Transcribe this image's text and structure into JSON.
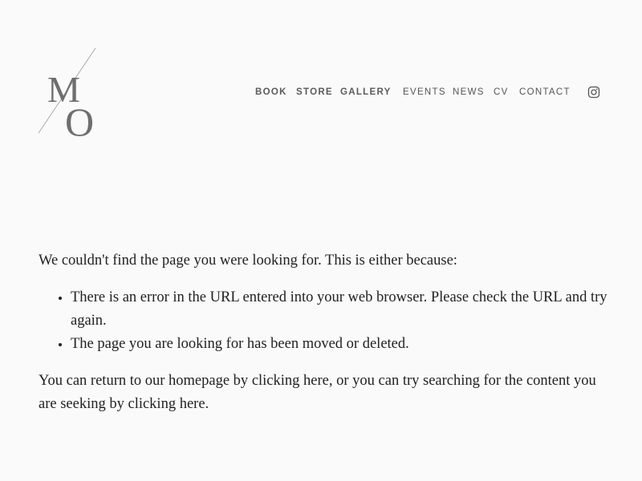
{
  "site": {
    "logo_letters": "MO",
    "nav": [
      {
        "label": "BOOK"
      },
      {
        "label": "STORE"
      },
      {
        "label": "GALLERY"
      },
      {
        "label": "EVENTS"
      },
      {
        "label": "NEWS"
      },
      {
        "label": "CV"
      },
      {
        "label": "CONTACT"
      }
    ],
    "social_icon": "instagram-icon"
  },
  "error_page": {
    "intro": "We couldn't find the page you were looking for. This is either because:",
    "reasons": [
      "There is an error in the URL entered into your web browser. Please check the URL and try again.",
      "The page you are looking for has been moved or deleted."
    ],
    "return_prefix": "You can return to our homepage by ",
    "link_home": "clicking here",
    "return_middle": ", or you can try searching for the content you are seeking by ",
    "link_search": "clicking here",
    "return_suffix": "."
  },
  "colors": {
    "background": "#fafafa",
    "text": "#222222",
    "nav_text": "#555555",
    "logo": "#777777"
  }
}
